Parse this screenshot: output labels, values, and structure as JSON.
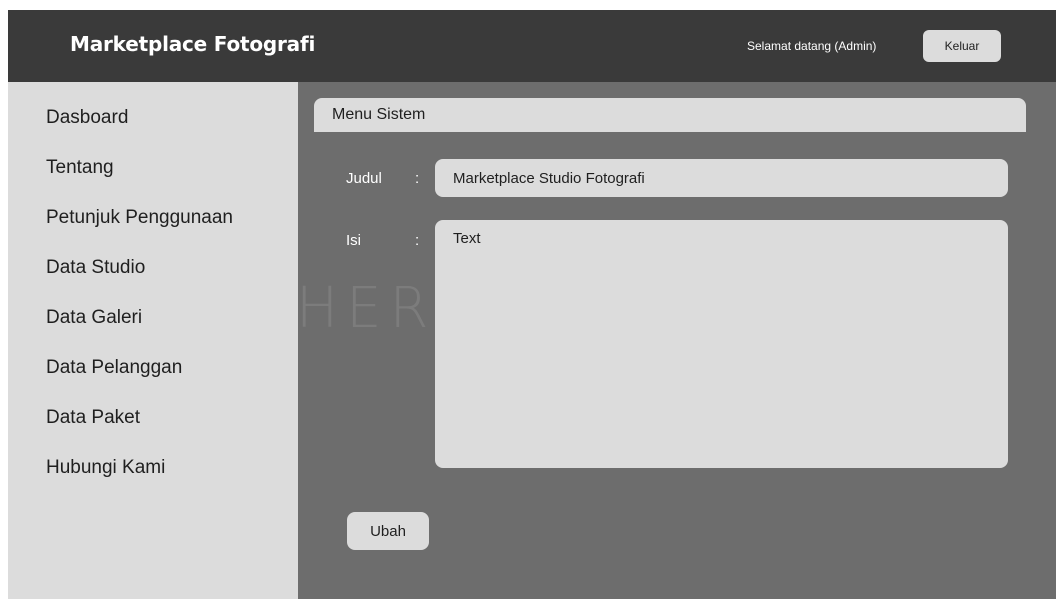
{
  "header": {
    "brand": "Marketplace Fotografi",
    "welcome_text": "Selamat datang (Admin)",
    "logout_label": "Keluar"
  },
  "sidebar": {
    "items": [
      {
        "label": "Dasboard"
      },
      {
        "label": "Tentang"
      },
      {
        "label": "Petunjuk Penggunaan"
      },
      {
        "label": "Data Studio"
      },
      {
        "label": "Data Galeri"
      },
      {
        "label": "Data Pelanggan"
      },
      {
        "label": "Data Paket"
      },
      {
        "label": "Hubungi Kami"
      }
    ]
  },
  "watermark": "HER",
  "main": {
    "section_title": "Menu Sistem",
    "form": {
      "title_label": "Judul",
      "title_colon": ":",
      "title_value": "Marketplace Studio Fotografi",
      "body_label": "Isi",
      "body_colon": ":",
      "body_value": "Text",
      "submit_label": "Ubah"
    }
  },
  "colors": {
    "topbar": "#3a3a3a",
    "sidebar": "#dcdcdc",
    "content_bg": "#6d6d6d",
    "field_bg": "#dcdcdc"
  }
}
